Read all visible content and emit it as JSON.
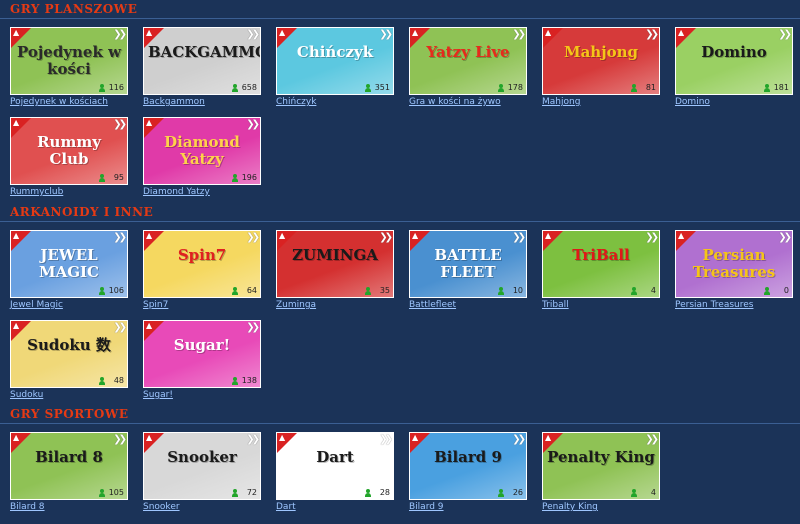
{
  "sections": [
    {
      "title": "GRY PLANSZOWE",
      "games": [
        {
          "name": "Pojedynek w kościach",
          "logo": "Pojedynek w kości",
          "count": "116",
          "bg": "#8fc255",
          "fg": "#2a2a2a",
          "icon": "dice-icon"
        },
        {
          "name": "Backgammon",
          "logo": "BACKGAMMON",
          "count": "658",
          "bg": "#cfcfcf",
          "fg": "#1a1a1a",
          "icon": "backgammon-icon"
        },
        {
          "name": "Chińczyk",
          "logo": "Chińczyk",
          "count": "351",
          "bg": "#5cc8e0",
          "fg": "#ffffff",
          "icon": "pawn-icon"
        },
        {
          "name": "Gra w kości na żywo",
          "logo": "Yatzy Live",
          "count": "178",
          "bg": "#8fc255",
          "fg": "#e62a1c",
          "icon": "dice-icon"
        },
        {
          "name": "Mahjong",
          "logo": "Mahjong",
          "count": "81",
          "bg": "#d63a3a",
          "fg": "#f5c518",
          "icon": "tile-icon"
        },
        {
          "name": "Domino",
          "logo": "Domino",
          "count": "181",
          "bg": "#9ad063",
          "fg": "#1a1a1a",
          "icon": "domino-icon"
        },
        {
          "name": "Rummyclub",
          "logo": "Rummy Club",
          "count": "95",
          "bg": "#e05050",
          "fg": "#ffffff",
          "icon": "cards-icon"
        },
        {
          "name": "Diamond Yatzy",
          "logo": "Diamond Yatzy",
          "count": "196",
          "bg": "#e03aa8",
          "fg": "#ffd24a",
          "icon": "diamond-icon"
        }
      ]
    },
    {
      "title": "ARKANOIDY I INNE",
      "games": [
        {
          "name": "Jewel Magic",
          "logo": "JEWEL MAGIC",
          "count": "106",
          "bg": "#6aa0e0",
          "fg": "#ffffff",
          "icon": "gem-icon"
        },
        {
          "name": "Spin7",
          "logo": "Spin7",
          "count": "64",
          "bg": "#f5d860",
          "fg": "#e02020",
          "icon": "slot-icon"
        },
        {
          "name": "Zuminga",
          "logo": "ZUMINGA",
          "count": "35",
          "bg": "#d43030",
          "fg": "#1a1a1a",
          "icon": "ball-icon"
        },
        {
          "name": "Battlefleet",
          "logo": "BATTLE FLEET",
          "count": "10",
          "bg": "#4a90d0",
          "fg": "#ffffff",
          "icon": "anchor-icon"
        },
        {
          "name": "Triball",
          "logo": "TriBall",
          "count": "4",
          "bg": "#7dc040",
          "fg": "#e01818",
          "icon": "ball-icon"
        },
        {
          "name": "Persian Treasures",
          "logo": "Persian Treasures",
          "count": "0",
          "bg": "#b070d0",
          "fg": "#f5c518",
          "icon": "treasure-icon"
        },
        {
          "name": "Sudoku",
          "logo": "Sudoku 数",
          "count": "48",
          "bg": "#f0d878",
          "fg": "#1a1a1a",
          "icon": "grid-icon"
        },
        {
          "name": "Sugar!",
          "logo": "Sugar!",
          "count": "138",
          "bg": "#e84ab8",
          "fg": "#ffffff",
          "icon": "candy-icon"
        }
      ]
    },
    {
      "title": "GRY SPORTOWE",
      "games": [
        {
          "name": "Bilard 8",
          "logo": "Bilard 8",
          "count": "105",
          "bg": "#8fc255",
          "fg": "#1a1a1a",
          "icon": "billiard-ball-icon"
        },
        {
          "name": "Snooker",
          "logo": "Snooker",
          "count": "72",
          "bg": "#d8d8d8",
          "fg": "#1a1a1a",
          "icon": "billiard-ball-icon"
        },
        {
          "name": "Dart",
          "logo": "Dart",
          "count": "28",
          "bg": "#ffffff",
          "fg": "#1a1a1a",
          "icon": "dart-icon"
        },
        {
          "name": "Bilard 9",
          "logo": "Bilard 9",
          "count": "26",
          "bg": "#4aa0e0",
          "fg": "#1a1a1a",
          "icon": "billiard-ball-icon"
        },
        {
          "name": "Penalty King",
          "logo": "Penalty King",
          "count": "4",
          "bg": "#8fc255",
          "fg": "#1a1a1a",
          "icon": "soccer-ball-icon"
        }
      ]
    }
  ]
}
